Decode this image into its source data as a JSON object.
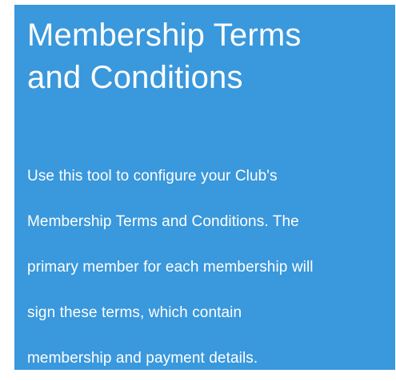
{
  "panel": {
    "background_color": "#3a98dc",
    "title_lines": [
      "Membership Terms",
      "and Conditions"
    ],
    "body_lines": [
      "Use this tool to configure your Club's",
      "Membership Terms and Conditions. The",
      "primary member for each membership will",
      "sign these terms, which contain",
      "membership and payment details."
    ]
  }
}
